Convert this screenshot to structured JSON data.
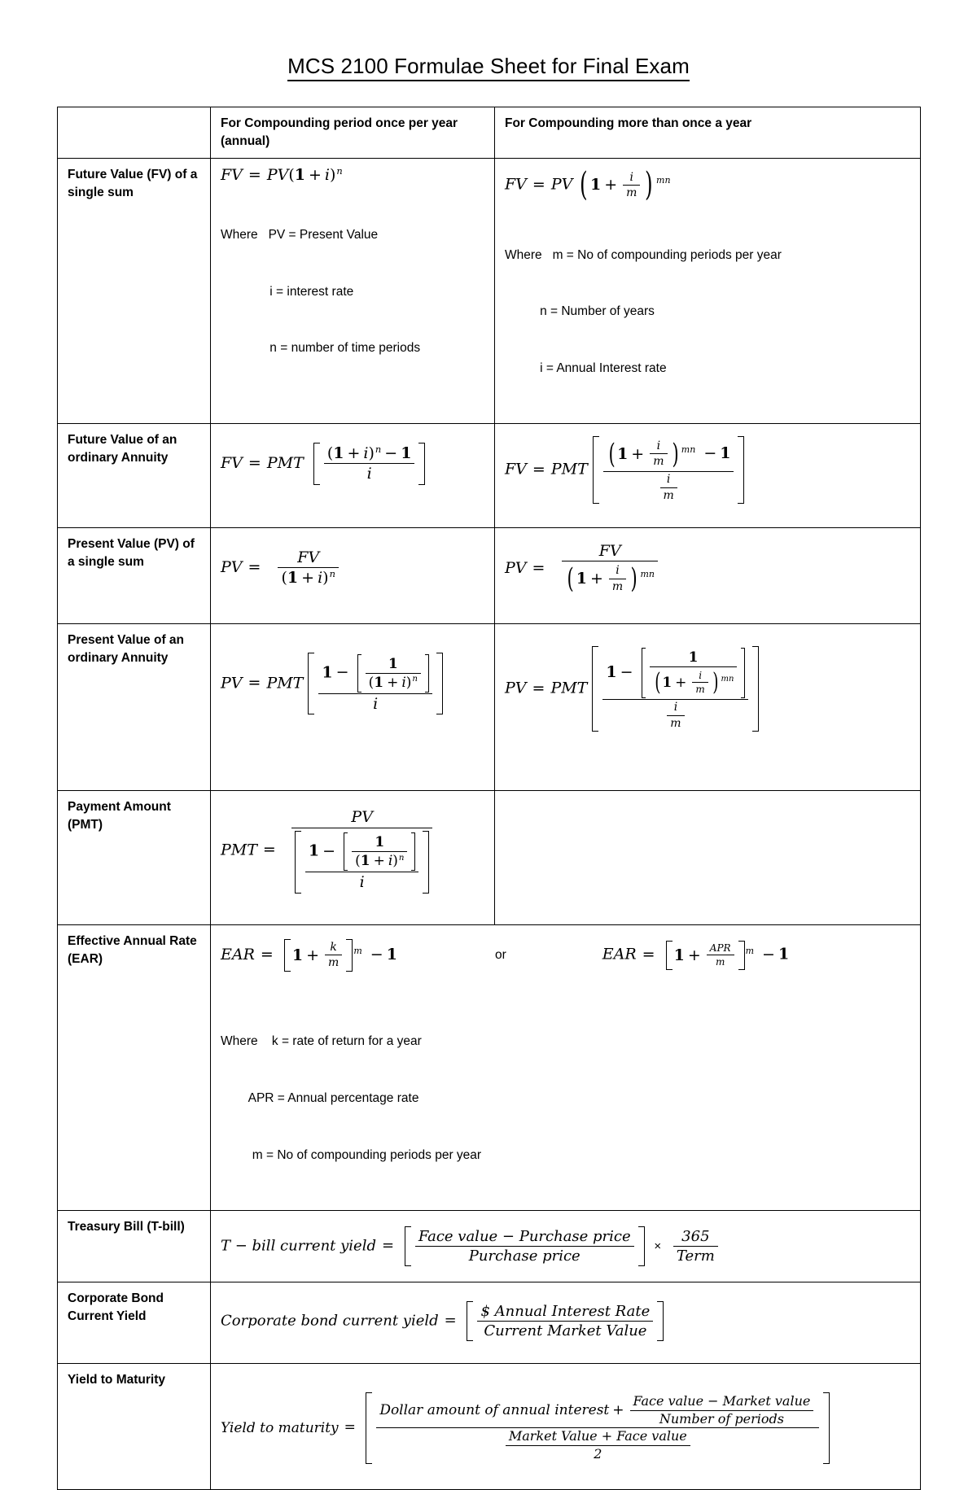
{
  "document": {
    "title": "MCS 2100 Formulae Sheet for Final Exam"
  },
  "table": {
    "headers": {
      "label_col": "",
      "annual": "For Compounding period once per year (annual)",
      "multi": "For Compounding more than once a year"
    },
    "rows": [
      {
        "label": "Future Value (FV) of a single sum",
        "annual": {
          "formula": "FV = PV(1 + i)^n",
          "where_intro": "Where",
          "definitions": [
            "PV = Present Value",
            "i = interest rate",
            "n = number of time periods"
          ]
        },
        "multi": {
          "formula": "FV = PV (1 + i/m)^(mn)",
          "where_intro": "Where",
          "definitions": [
            "m = No of compounding periods per year",
            "n = Number of years",
            "i = Annual Interest rate"
          ]
        }
      },
      {
        "label": "Future Value of an ordinary Annuity",
        "annual": {
          "formula": "FV = PMT [ ((1 + i)^n - 1) / i ]"
        },
        "multi": {
          "formula": "FV = PMT [ ((1 + i/m)^(mn) - 1) / (i/m) ]"
        }
      },
      {
        "label": "Present Value (PV) of a single sum",
        "annual": {
          "formula": "PV = FV / (1 + i)^n"
        },
        "multi": {
          "formula": "PV = FV / (1 + i/m)^(mn)"
        }
      },
      {
        "label": "Present Value of an ordinary Annuity",
        "annual": {
          "formula": "PV = PMT [ (1 - [1/(1 + i)^n]) / i ]"
        },
        "multi": {
          "formula": "PV = PMT [ (1 - [1/(1 + i/m)^(mn)]) / (i/m) ]"
        }
      },
      {
        "label": "Payment Amount (PMT)",
        "annual": {
          "formula": "PMT = PV / [ (1 - [1/(1 + i)^n]) / i ]"
        },
        "multi": {
          "formula": ""
        }
      },
      {
        "label": "Effective Annual Rate (EAR)",
        "formula_left": "EAR = [1 + k/m]^m - 1",
        "connector": "or",
        "formula_right": "EAR = [1 + APR/m]^m - 1",
        "where_intro": "Where",
        "definitions": [
          "k = rate of return for a year",
          "APR = Annual percentage rate",
          "m = No of compounding periods per year"
        ]
      },
      {
        "label": "Treasury Bill (T-bill)",
        "formula": "T - bill current yield = [ (Face value - Purchase price) / Purchase price ] x (365 / Term)"
      },
      {
        "label": "Corporate Bond Current Yield",
        "formula": "Corporate bond current yield = [ $ Annual Interest Rate / Current Market Value ]"
      },
      {
        "label": "Yield to Maturity",
        "formula": "Yield to maturity = [ (Dollar amount of annual interest + (Face value - Market value)/(Number of periods)) / ((Market Value + Face value)/2) ]"
      }
    ],
    "math_terms": {
      "FV": "FV",
      "PV": "PV",
      "PMT": "PMT",
      "EAR": "EAR",
      "APR": "APR",
      "i": "i",
      "m": "m",
      "n": "n",
      "k": "k",
      "mn": "mn",
      "one": "1",
      "two": "2",
      "365": "365",
      "Term": "Term",
      "eq": "=",
      "plus": "+",
      "minus": "−",
      "times": "×",
      "face_value": "Face value",
      "purchase_price": "Purchase price",
      "market_value": "Market value",
      "market_value_cap": "Market Value",
      "number_of_periods": "Number of periods",
      "annual_interest_rate": "$ Annual Interest Rate",
      "current_market_value": "Current Market Value",
      "dollar_annual_interest": "Dollar amount of annual interest",
      "tbill_lead": "T − bill current yield",
      "corp_lead": "Corporate bond current yield",
      "ytm_lead": "Yield to maturity"
    }
  }
}
